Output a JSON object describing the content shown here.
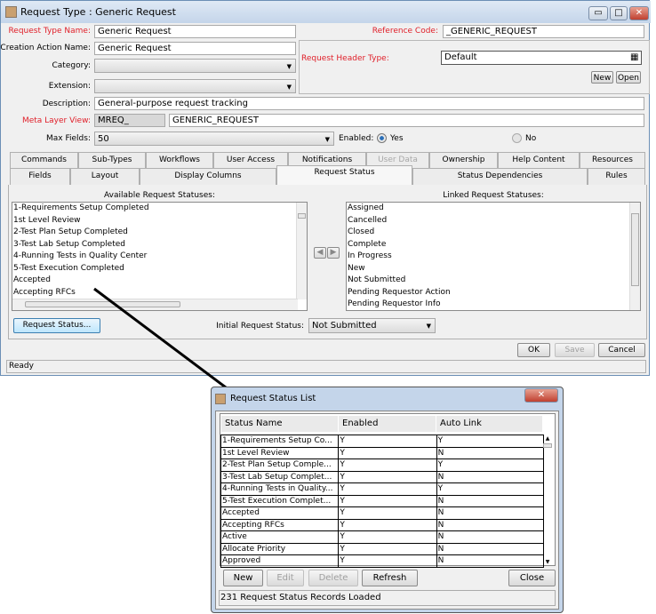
{
  "window": {
    "title": "Request Type : Generic Request",
    "min": "▭",
    "max": "□",
    "close": "✕"
  },
  "form": {
    "request_type_name_label": "Request Type Name:",
    "request_type_name": "Generic Request",
    "reference_code_label": "Reference Code:",
    "reference_code": "_GENERIC_REQUEST",
    "creation_action_name_label": "Creation Action Name:",
    "creation_action_name": "Generic Request",
    "request_header_type_label": "Request Header Type:",
    "request_header_type": "Default",
    "new_label": "New",
    "open_label": "Open",
    "category_label": "Category:",
    "category": "",
    "extension_label": "Extension:",
    "extension": "",
    "description_label": "Description:",
    "description": "General-purpose request tracking",
    "meta_layer_view_label": "Meta Layer View:",
    "meta_prefix": "MREQ_",
    "meta_view": "GENERIC_REQUEST",
    "max_fields_label": "Max Fields:",
    "max_fields": "50",
    "enabled_label": "Enabled:",
    "yes_label": "Yes",
    "no_label": "No",
    "enabled_value": "Yes"
  },
  "tabs_row1": [
    "Commands",
    "Sub-Types",
    "Workflows",
    "User Access",
    "Notifications",
    "User Data",
    "Ownership",
    "Help Content",
    "Resources"
  ],
  "tabs_row2": [
    "Fields",
    "Layout",
    "Display Columns",
    "Request Status",
    "Status Dependencies",
    "Rules"
  ],
  "active_tab": "Request Status",
  "status_tab": {
    "available_label": "Available Request Statuses:",
    "available": [
      "1-Requirements Setup Completed",
      "1st Level Review",
      "2-Test Plan Setup Completed",
      "3-Test Lab Setup Completed",
      "4-Running Tests in Quality Center",
      "5-Test Execution Completed",
      "Accepted",
      "Accepting RFCs"
    ],
    "linked_label": "Linked Request Statuses:",
    "linked": [
      "Assigned",
      "Cancelled",
      "Closed",
      "Complete",
      "In Progress",
      "New",
      "Not Submitted",
      "Pending Requestor Action",
      "Pending Requestor Info"
    ],
    "request_status_button": "Request Status...",
    "initial_label": "Initial Request Status:",
    "initial_value": "Not Submitted"
  },
  "footer": {
    "ok": "OK",
    "save": "Save",
    "cancel": "Cancel",
    "status": "Ready"
  },
  "dialog": {
    "title": "Request Status List",
    "close": "✕",
    "columns": [
      "Status Name",
      "Enabled",
      "Auto Link"
    ],
    "rows": [
      [
        "1-Requirements Setup Co...",
        "Y",
        "Y"
      ],
      [
        "1st Level Review",
        "Y",
        "N"
      ],
      [
        "2-Test Plan Setup Comple...",
        "Y",
        "Y"
      ],
      [
        "3-Test Lab Setup Complet...",
        "Y",
        "N"
      ],
      [
        "4-Running Tests in Quality...",
        "Y",
        "Y"
      ],
      [
        "5-Test Execution Complet...",
        "Y",
        "N"
      ],
      [
        "Accepted",
        "Y",
        "N"
      ],
      [
        "Accepting RFCs",
        "Y",
        "N"
      ],
      [
        "Active",
        "Y",
        "N"
      ],
      [
        "Allocate Priority",
        "Y",
        "N"
      ],
      [
        "Approved",
        "Y",
        "N"
      ]
    ],
    "buttons": {
      "new": "New",
      "edit": "Edit",
      "delete": "Delete",
      "refresh": "Refresh",
      "close": "Close"
    },
    "status": "231 Request Status Records Loaded"
  }
}
